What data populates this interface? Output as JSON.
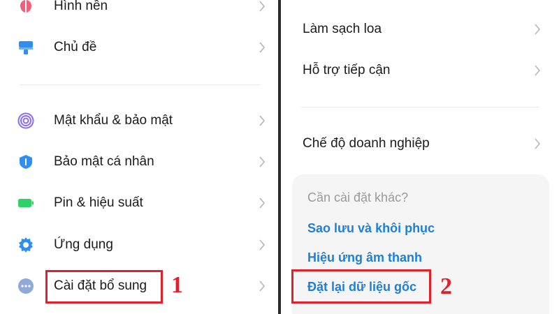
{
  "left_menu": {
    "items": [
      {
        "label": "Hình nền",
        "icon": "wallpaper-icon",
        "color": "#f0607a"
      },
      {
        "label": "Chủ đề",
        "icon": "theme-brush-icon",
        "color": "#2f8ff0"
      },
      {
        "label": "Mật khẩu & bảo mật",
        "icon": "fingerprint-icon",
        "color": "#8a6cf0"
      },
      {
        "label": "Bảo mật cá nhân",
        "icon": "shield-icon",
        "color": "#2f8ff0"
      },
      {
        "label": "Pin & hiệu suất",
        "icon": "battery-icon",
        "color": "#2fd06a"
      },
      {
        "label": "Ứng dụng",
        "icon": "gear-icon",
        "color": "#2f8ff0"
      },
      {
        "label": "Cài đặt bổ sung",
        "icon": "more-dots-icon",
        "color": "#8fa9d8"
      }
    ]
  },
  "right_menu": {
    "items": [
      {
        "label": "Làm sạch loa"
      },
      {
        "label": "Hỗ trợ tiếp cận"
      },
      {
        "label": "Chế độ doanh nghiệp"
      }
    ]
  },
  "other_settings": {
    "title": "Cần cài đặt khác?",
    "links": [
      {
        "label": "Sao lưu và khôi phục"
      },
      {
        "label": "Hiệu ứng âm thanh"
      },
      {
        "label": "Đặt lại dữ liệu gốc"
      }
    ]
  },
  "annotations": {
    "step1": "1",
    "step2": "2",
    "highlight_color": "#e0202a"
  }
}
